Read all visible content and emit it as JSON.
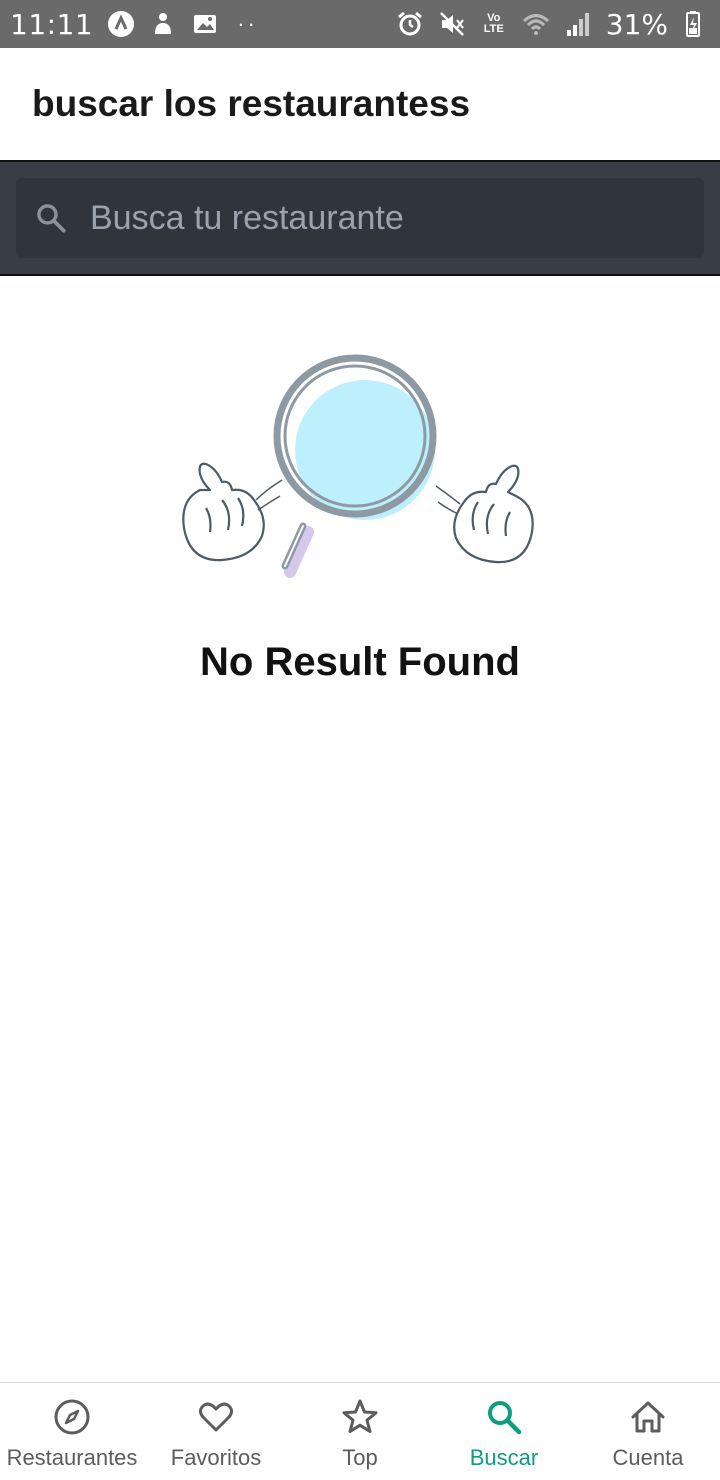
{
  "status_bar": {
    "time": "11:11",
    "battery": "31%",
    "volte": "Vo\nLTE",
    "icons": [
      "android-icon",
      "notification-icon",
      "image-icon",
      "alarm-icon",
      "mute-icon",
      "volte-icon",
      "wifi-icon",
      "signal-icon",
      "battery-icon"
    ]
  },
  "header": {
    "title": "buscar los restaurantess"
  },
  "search": {
    "placeholder": "Busca tu restaurante",
    "value": "",
    "icon": "search-icon"
  },
  "empty_state": {
    "illustration": "magnifier-shrug-illustration",
    "message": "No Result Found"
  },
  "bottom_nav": {
    "active_color": "#0f9d80",
    "inactive_color": "#5c5c5c",
    "items": [
      {
        "label": "Restaurantes",
        "icon": "compass-icon",
        "active": false
      },
      {
        "label": "Favoritos",
        "icon": "heart-icon",
        "active": false
      },
      {
        "label": "Top",
        "icon": "star-icon",
        "active": false
      },
      {
        "label": "Buscar",
        "icon": "search-icon",
        "active": true
      },
      {
        "label": "Cuenta",
        "icon": "home-icon",
        "active": false
      }
    ]
  }
}
